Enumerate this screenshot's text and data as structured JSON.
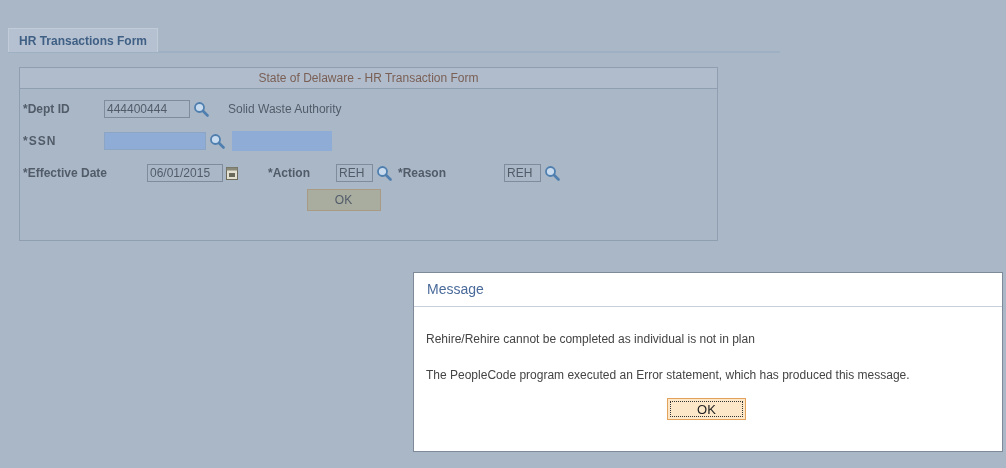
{
  "tabs": [
    {
      "label": "HR Transactions Form",
      "selected": true
    }
  ],
  "form": {
    "title": "State of Delaware - HR Transaction Form",
    "dept_id": {
      "label": "*Dept ID",
      "value": "444400444",
      "description": "Solid Waste Authority"
    },
    "ssn": {
      "label": "*SSN"
    },
    "effective_date": {
      "label": "*Effective Date",
      "value": "06/01/2015"
    },
    "action": {
      "label": "*Action",
      "value": "REH"
    },
    "reason": {
      "label": "*Reason",
      "value": "REH"
    },
    "button": "OK"
  },
  "message": {
    "title": "Message",
    "lines": [
      "Rehire/Rehire cannot be completed as individual is not in plan",
      "The PeopleCode program executed an Error statement, which has produced this message."
    ],
    "button": "OK"
  }
}
